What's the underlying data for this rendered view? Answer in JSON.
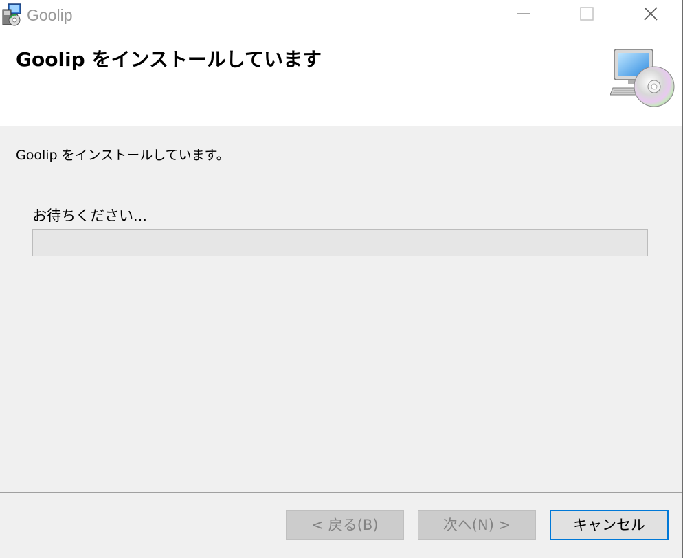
{
  "window": {
    "title": "Goolip",
    "icon": "installer-icon"
  },
  "controls": {
    "minimize_icon": "minimize-icon",
    "maximize_icon": "maximize-icon",
    "close_icon": "close-icon"
  },
  "banner": {
    "title": "Goolip をインストールしています",
    "icon": "computer-cd-icon"
  },
  "body": {
    "status": "Goolip をインストールしています。",
    "wait_label": "お待ちください...",
    "progress_percent": 0
  },
  "buttons": {
    "back_label": "< 戻る(B)",
    "back_enabled": false,
    "next_label": "次へ(N) >",
    "next_enabled": false,
    "cancel_label": "キャンセル",
    "cancel_enabled": true
  },
  "colors": {
    "accent": "#0078d7",
    "progress_fill": "#06b025",
    "disabled_button": "#cccccc",
    "disabled_text": "#838383"
  }
}
